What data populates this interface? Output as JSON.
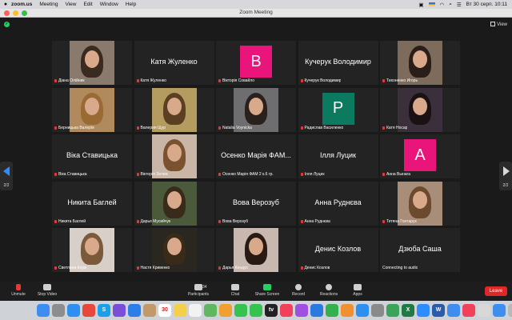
{
  "menubar": {
    "app": "zoom.us",
    "items": [
      "Meeting",
      "View",
      "Edit",
      "Window",
      "Help"
    ],
    "clock": "Вт 30 серп.  10:11"
  },
  "window": {
    "title": "Zoom Meeting"
  },
  "view_label": "View",
  "pagination": {
    "left": "2/2",
    "right": "2/2"
  },
  "tiles": [
    {
      "label": "Діана Олійник",
      "type": "photo",
      "bg": "#8a7a6e",
      "hair": "#3b2a20"
    },
    {
      "label": "Катя Жуленко",
      "type": "name",
      "display": "Катя Жуленко"
    },
    {
      "label": "Вікторія Совайло",
      "type": "avatar",
      "initial": "В",
      "color": "#e9157a"
    },
    {
      "label": "Кучерук Володимир",
      "type": "name",
      "display": "Кучерук Володимир"
    },
    {
      "label": "Тихоненко Игорь",
      "type": "photo",
      "bg": "#7d6b5c",
      "hair": "#2a1f18"
    },
    {
      "label": "Берницька Валерія",
      "type": "photo",
      "bg": "#b08a5c",
      "hair": "#9a6a35"
    },
    {
      "label": "Валерия Щур",
      "type": "photo",
      "bg": "#b49b5f",
      "hair": "#5b3f22"
    },
    {
      "label": "Natalia Voynicka",
      "type": "photo",
      "bg": "#6e6e70",
      "hair": "#2b211c"
    },
    {
      "label": "Радислав Василенко",
      "type": "avatar",
      "initial": "Р",
      "color": "#0b7a5f"
    },
    {
      "label": "Катя Носар",
      "type": "photo",
      "bg": "#3a2f3a",
      "hair": "#1a1212"
    },
    {
      "label": "Віка Ставицька",
      "type": "name",
      "display": "Віка Ставицька"
    },
    {
      "label": "Вікторія Зелюк",
      "type": "photo",
      "bg": "#c9b6a6",
      "hair": "#7a5230"
    },
    {
      "label": "Осенко Марія ФАМ 2 к.6 гр.",
      "type": "name",
      "display": "Осенко Марія ФАМ..."
    },
    {
      "label": "Ілля Луцик",
      "type": "name",
      "display": "Ілля Луцик"
    },
    {
      "label": "Анна Вынага",
      "type": "avatar",
      "initial": "А",
      "color": "#e9157a"
    },
    {
      "label": "Никита Баглей",
      "type": "name",
      "display": "Никита Баглей"
    },
    {
      "label": "Дарья Мусийчук",
      "type": "photo",
      "bg": "#4a5a3a",
      "hair": "#3a2a1a"
    },
    {
      "label": "Вова Верозуб",
      "type": "name",
      "display": "Вова Верозуб"
    },
    {
      "label": "Анна Руднєва",
      "type": "name",
      "display": "Анна Руднєва"
    },
    {
      "label": "Тетяна Гонтарук",
      "type": "photo",
      "bg": "#a88d78",
      "hair": "#6b4a2e"
    },
    {
      "label": "Светлана Корж",
      "type": "photo",
      "bg": "#d8cfc8",
      "hair": "#7a5a3a"
    },
    {
      "label": "Настя Кривенко",
      "type": "photo",
      "bg": "#2a2620",
      "hair": "#3a2a18"
    },
    {
      "label": "Дарья Кендус",
      "type": "photo",
      "bg": "#c8b8b0",
      "hair": "#2a1a14"
    },
    {
      "label": "Денис Козлов",
      "type": "name",
      "display": "Денис Козлов"
    },
    {
      "label": "Connecting to audio",
      "type": "name",
      "display": "Дзюба Саша"
    }
  ],
  "toolbar": {
    "unmute": "Unmute",
    "stop_video": "Stop Video",
    "participants": "Participants",
    "participants_count": "34",
    "chat": "Chat",
    "share": "Share Screen",
    "record": "Record",
    "reactions": "Reactions",
    "apps": "Apps",
    "leave": "Leave"
  },
  "dock_apps": [
    {
      "icon": "finder-icon",
      "color": "#3d8ef0",
      "glyph": ""
    },
    {
      "icon": "launchpad-icon",
      "color": "#8d8d8d",
      "glyph": ""
    },
    {
      "icon": "safari-icon",
      "color": "#2f8ff0",
      "glyph": ""
    },
    {
      "icon": "chrome-icon",
      "color": "#e8483b",
      "glyph": ""
    },
    {
      "icon": "skype-icon",
      "color": "#1aa0e6",
      "glyph": "S"
    },
    {
      "icon": "viber-icon",
      "color": "#7b4ed8",
      "glyph": ""
    },
    {
      "icon": "mail-icon",
      "color": "#2b7ee8",
      "glyph": ""
    },
    {
      "icon": "contacts-icon",
      "color": "#c29a6a",
      "glyph": ""
    },
    {
      "icon": "calendar-icon",
      "color": "#ffffff",
      "glyph": "30"
    },
    {
      "icon": "notes-icon",
      "color": "#f4d04a",
      "glyph": ""
    },
    {
      "icon": "reminders-icon",
      "color": "#f2f2f2",
      "glyph": ""
    },
    {
      "icon": "maps-icon",
      "color": "#5fb85f",
      "glyph": ""
    },
    {
      "icon": "photos-icon",
      "color": "#f0a030",
      "glyph": ""
    },
    {
      "icon": "facetime-icon",
      "color": "#35c24f",
      "glyph": ""
    },
    {
      "icon": "messages-icon",
      "color": "#35c24f",
      "glyph": ""
    },
    {
      "icon": "appletv-icon",
      "color": "#222222",
      "glyph": "tv"
    },
    {
      "icon": "music-icon",
      "color": "#f0405a",
      "glyph": ""
    },
    {
      "icon": "podcasts-icon",
      "color": "#a050e0",
      "glyph": ""
    },
    {
      "icon": "keynote-icon",
      "color": "#2a7ae0",
      "glyph": ""
    },
    {
      "icon": "numbers-icon",
      "color": "#35b04f",
      "glyph": ""
    },
    {
      "icon": "pages-icon",
      "color": "#f09030",
      "glyph": ""
    },
    {
      "icon": "appstore-icon",
      "color": "#2f8ff0",
      "glyph": ""
    },
    {
      "icon": "settings-icon",
      "color": "#8a8a8a",
      "glyph": ""
    },
    {
      "icon": "chrome2-icon",
      "color": "#3aa55a",
      "glyph": ""
    },
    {
      "icon": "excel-icon",
      "color": "#1f7a45",
      "glyph": "X"
    },
    {
      "icon": "zoom-icon",
      "color": "#2d8cff",
      "glyph": ""
    },
    {
      "icon": "word-icon",
      "color": "#2a5caa",
      "glyph": "W"
    },
    {
      "icon": "finder2-icon",
      "color": "#3d8ef0",
      "glyph": ""
    },
    {
      "icon": "music2-icon",
      "color": "#f0405a",
      "glyph": ""
    },
    {
      "icon": "pdf-icon",
      "color": "#d8d8d8",
      "glyph": ""
    },
    {
      "icon": "downloads-icon",
      "color": "#3d8ef0",
      "glyph": ""
    },
    {
      "icon": "trash-icon",
      "color": "#b8b8b8",
      "glyph": ""
    }
  ]
}
